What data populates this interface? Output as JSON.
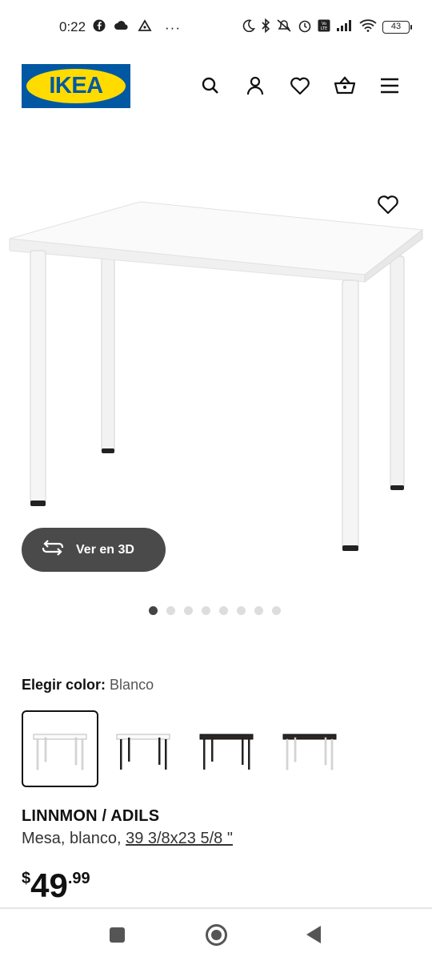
{
  "status_bar": {
    "time": "0:22",
    "more": "···",
    "battery": "43"
  },
  "header": {
    "logo_text": "IKEA",
    "brand_blue": "#0058a3",
    "brand_yellow": "#ffdb00",
    "icons": [
      "search-icon",
      "account-icon",
      "favorites-icon",
      "cart-icon",
      "menu-icon"
    ]
  },
  "gallery": {
    "view_3d_label": "Ver en 3D",
    "image_count": 8,
    "active_index": 0
  },
  "color_selector": {
    "label": "Elegir color:",
    "value": "Blanco",
    "options": [
      "white-white",
      "white-black",
      "black-black",
      "black-white"
    ]
  },
  "product": {
    "name": "LINNMON / ADILS",
    "desc_prefix": "Mesa, blanco,",
    "dimensions": "39 3/8x23 5/8 \"",
    "price_currency": "$",
    "price_int": "49",
    "price_dec": ".99"
  }
}
